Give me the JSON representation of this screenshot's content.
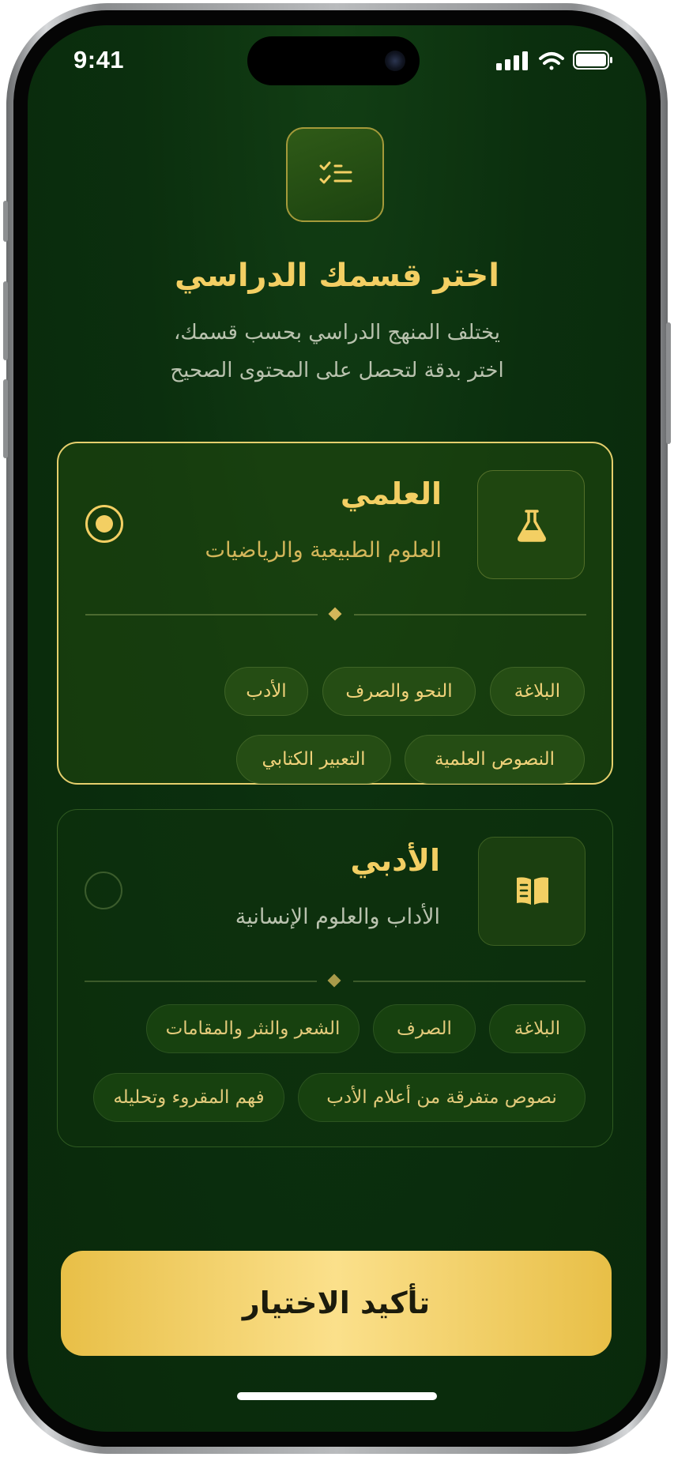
{
  "status_bar": {
    "time": "9:41"
  },
  "header": {
    "title": "اختر قسمك الدراسي",
    "subtitle_line1": "يختلف المنهج الدراسي بحسب قسمك،",
    "subtitle_line2": "اختر بدقة لتحصل على المحتوى الصحيح",
    "icon": "checklist-icon"
  },
  "tracks": [
    {
      "title": "العلمي",
      "subtitle": "العلوم الطبيعية والرياضيات",
      "icon": "flask-icon",
      "selected": true,
      "subjects_row1": [
        "البلاغة",
        "النحو والصرف",
        "الأدب"
      ],
      "subjects_row2": [
        "النصوص العلمية",
        "التعبير الكتابي"
      ]
    },
    {
      "title": "الأدبي",
      "subtitle": "الأداب والعلوم الإنسانية",
      "icon": "open-book-icon",
      "selected": false,
      "subjects_row1": [
        "البلاغة",
        "الصرف",
        "الشعر والنثر والمقامات"
      ],
      "subjects_row2": [
        "نصوص متفرقة من أعلام الأدب",
        "فهم المقروء وتحليله"
      ]
    }
  ],
  "confirm_button": {
    "label": "تأكيد الاختيار"
  },
  "colors": {
    "background": "#0b2f0e",
    "gold": "#f3cf63",
    "selected_border": "#e5cf6d",
    "button_gold": "#fbe08b"
  }
}
